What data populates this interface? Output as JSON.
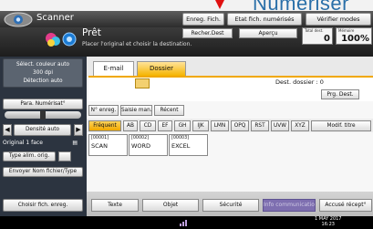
{
  "banner": {
    "text": "Numériser"
  },
  "titlebar": {
    "app_name": "Scanner",
    "buttons": [
      "Enreg. Fich.",
      "Etat fich. numérisés",
      "Vérifier modes"
    ]
  },
  "status": {
    "main": "Prêt",
    "sub": "Placer l'original et choisir la destination.",
    "dest_search": "Recher.Dest",
    "preview": "Aperçu",
    "counter_total_label": "Total dest.",
    "counter_total": "0",
    "counter_memory_label": "Mémoire",
    "counter_memory": "100%"
  },
  "left": {
    "color_lines": [
      "Sélect. couleur auto",
      "300 dpi",
      "Détection auto"
    ],
    "scan_param": "Para. Numérisat°",
    "density": "Densité auto",
    "orig_one": "Original 1 face",
    "orig_type": "Type alim. orig.",
    "send_name": "Envoyer Nom fichier/Type",
    "choose_file": "Choisir fich. enreg."
  },
  "tabs": {
    "email": "E-mail",
    "folder": "Dossier"
  },
  "folder": {
    "dest_count": "Dest. dossier :   0",
    "prev_dest": "Prg. Dest."
  },
  "filters": [
    "N° enreg.",
    "Saisie man.",
    "Récent"
  ],
  "alpha": [
    "Fréquent",
    "AB",
    "CD",
    "EF",
    "GH",
    "IJK",
    "LMN",
    "OPQ",
    "RST",
    "UVW",
    "XYZ",
    "Modif. titre"
  ],
  "destinations": [
    {
      "num": "[00001]",
      "name": "SCAN"
    },
    {
      "num": "[00002]",
      "name": "WORD"
    },
    {
      "num": "[00003]",
      "name": "EXCEL"
    }
  ],
  "bottom_buttons": [
    "Texte",
    "Objet",
    "Sécurité",
    "Info communication",
    "Accusé récept°"
  ],
  "footer": {
    "date": "1 MAY 2017",
    "time": "16:23"
  },
  "colors": {
    "accent": "#f0a800",
    "dark": "#2c3440",
    "banner": "#2a6fa8",
    "arrow": "#e01010"
  }
}
